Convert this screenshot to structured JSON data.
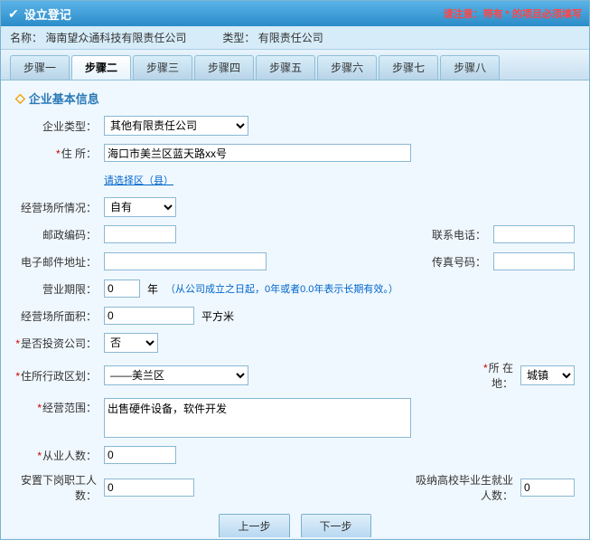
{
  "window": {
    "title": "设立登记",
    "notice": "请注意：带有",
    "notice_mark": "*",
    "notice_end": "的项目必须填写"
  },
  "info": {
    "name_label": "名称：",
    "name_value": "海南望众通科技有限责任公司",
    "type_label": "类型：",
    "type_value": "有限责任公司"
  },
  "tabs": [
    "步骤一",
    "步骤二",
    "步骤三",
    "步骤四",
    "步骤五",
    "步骤六",
    "步骤七",
    "步骤八"
  ],
  "active_tab": 1,
  "section_title": "企业基本信息",
  "form": {
    "company_type_label": "企业类型：",
    "company_type_value": "其他有限责任公司",
    "address_label": "住  所：",
    "address_required": true,
    "address_value": "海口市美兰区蓝天路xx号",
    "address_link": "请选择区（县）",
    "operation_status_label": "经营场所情况：",
    "operation_status_value": "自有",
    "postal_code_label": "邮政编码：",
    "postal_code_value": "",
    "phone_label": "联系电话：",
    "phone_value": "",
    "email_label": "电子邮件地址：",
    "email_value": "",
    "fax_label": "传真号码：",
    "fax_value": "",
    "business_term_label": "营业期限：",
    "business_term_value": "0",
    "business_term_unit": "年",
    "business_term_hint": "（从公司成立之日起，0年或者0.0年表示长期有效。）",
    "area_label": "经营场所面积：",
    "area_value": "0",
    "area_unit": "平方米",
    "invest_label": "是否投资公司：",
    "invest_required": true,
    "invest_value": "否",
    "district_label": "住所行政区划：",
    "district_required": true,
    "district_value": "——美兰区",
    "location_label": "所 在 地：",
    "location_required": true,
    "location_value": "城镇",
    "scope_label": "经营范围：",
    "scope_required": true,
    "scope_value": "出售硬件设备，软件开发",
    "employees_label": "从业人数：",
    "employees_required": true,
    "employees_value": "0",
    "settle_workers_label": "安置下岗职工人数：",
    "settle_workers_value": "0",
    "hire_graduates_label": "吸纳高校毕业生就业人数：",
    "hire_graduates_value": "0"
  },
  "buttons": {
    "prev": "上一步",
    "next": "下一步"
  }
}
